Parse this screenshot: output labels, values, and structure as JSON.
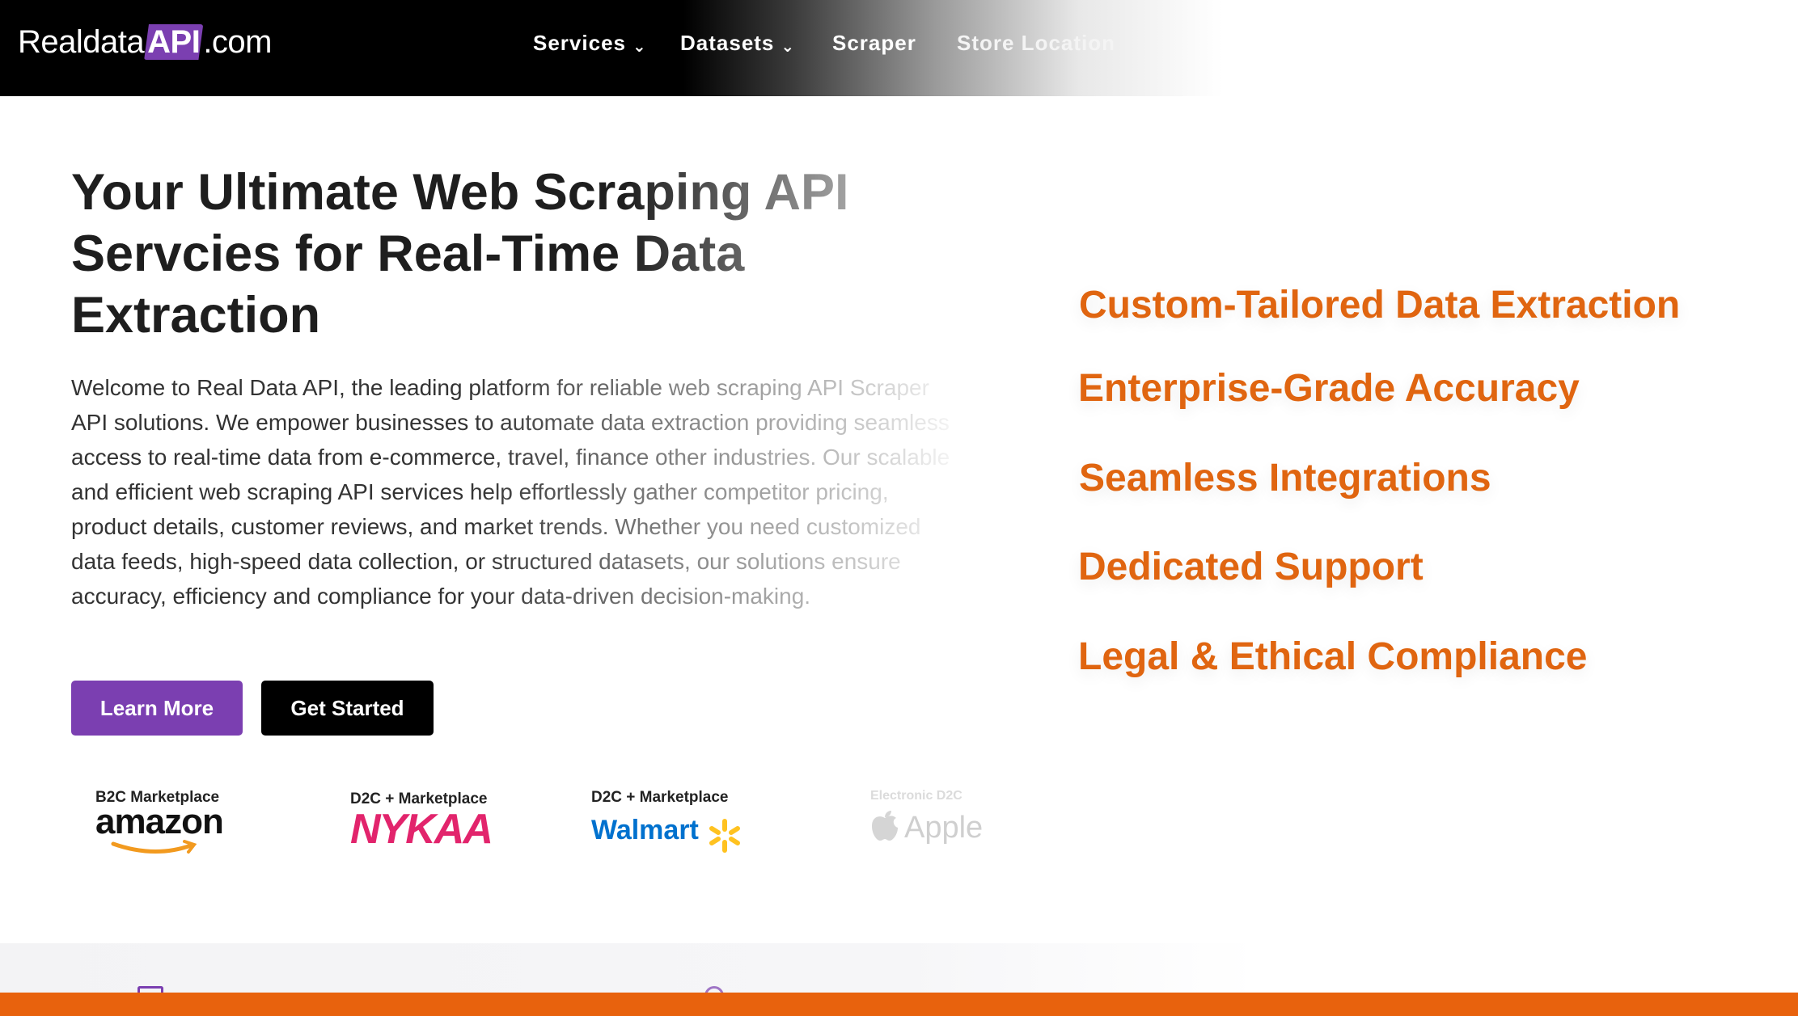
{
  "header": {
    "logo_prefix": "Realdata",
    "logo_api": "API",
    "logo_suffix": ".com",
    "nav": [
      {
        "label": "Services",
        "dropdown": true
      },
      {
        "label": "Datasets",
        "dropdown": true
      },
      {
        "label": "Scraper",
        "dropdown": false
      },
      {
        "label": "Store Location",
        "dropdown": false
      }
    ]
  },
  "hero": {
    "title": "Your Ultimate Web Scraping API Servcies for Real-Time Data Extraction",
    "description": "Welcome to Real Data API, the leading platform for reliable web scraping API Scraper API solutions. We empower businesses to automate data extraction providing seamless access to real-time data from e-commerce, travel, finance other industries. Our scalable and efficient web scraping API services help effortlessly gather competitor pricing, product details, customer reviews, and market trends. Whether you need customized data feeds, high-speed data collection, or structured datasets, our solutions ensure accuracy, efficiency and compliance for your data-driven decision-making.",
    "learn_more": "Learn More",
    "get_started": "Get Started"
  },
  "brands": [
    {
      "caption": "B2C Marketplace",
      "name": "amazon"
    },
    {
      "caption": "D2C + Marketplace",
      "name": "NYKAA"
    },
    {
      "caption": "D2C + Marketplace",
      "name": "Walmart"
    },
    {
      "caption": "Electronic D2C",
      "name": "Apple"
    }
  ],
  "features": [
    "Custom-Tailored Data Extraction",
    "Enterprise-Grade Accuracy",
    "Seamless Integrations",
    "Dedicated Support",
    "Legal & Ethical Compliance"
  ],
  "colors": {
    "accent_purple": "#7b3fb1",
    "accent_orange": "#e06510",
    "button_dark": "#000000"
  }
}
